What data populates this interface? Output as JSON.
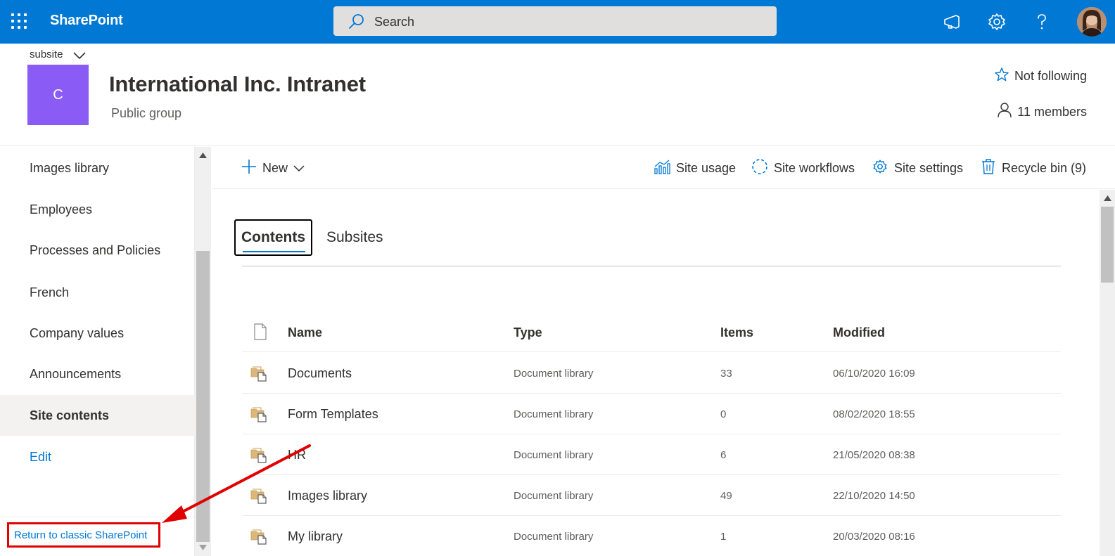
{
  "suite": {
    "brand": "SharePoint",
    "search_placeholder": "Search",
    "accent": "#0078d4"
  },
  "site": {
    "subsite_label": "subsite",
    "logo_letter": "C",
    "logo_color": "#8a5cf5",
    "title": "International Inc. Intranet",
    "subtitle": "Public group",
    "follow_label": "Not following",
    "members_label": "11 members"
  },
  "nav": {
    "items": [
      {
        "label": "Images library"
      },
      {
        "label": "Employees"
      },
      {
        "label": "Processes and Policies"
      },
      {
        "label": "French"
      },
      {
        "label": "Company values"
      },
      {
        "label": "Announcements"
      },
      {
        "label": "Site contents",
        "active": true
      },
      {
        "label": "Edit"
      }
    ],
    "classic_link": "Return to classic SharePoint"
  },
  "commands": {
    "new_label": "New",
    "site_usage": "Site usage",
    "site_workflows": "Site workflows",
    "site_settings": "Site settings",
    "recycle_bin": "Recycle bin (9)"
  },
  "tabs": [
    {
      "label": "Contents",
      "selected": true
    },
    {
      "label": "Subsites",
      "selected": false
    }
  ],
  "table": {
    "columns": {
      "name": "Name",
      "type": "Type",
      "items": "Items",
      "modified": "Modified"
    },
    "rows": [
      {
        "name": "Documents",
        "type": "Document library",
        "items": "33",
        "modified": "06/10/2020 16:09"
      },
      {
        "name": "Form Templates",
        "type": "Document library",
        "items": "0",
        "modified": "08/02/2020 18:55"
      },
      {
        "name": "HR",
        "type": "Document library",
        "items": "6",
        "modified": "21/05/2020 08:38"
      },
      {
        "name": "Images library",
        "type": "Document library",
        "items": "49",
        "modified": "22/10/2020 14:50"
      },
      {
        "name": "My library",
        "type": "Document library",
        "items": "1",
        "modified": "20/03/2020 08:16"
      }
    ]
  },
  "annotation": {
    "highlight_color": "#e00000"
  }
}
